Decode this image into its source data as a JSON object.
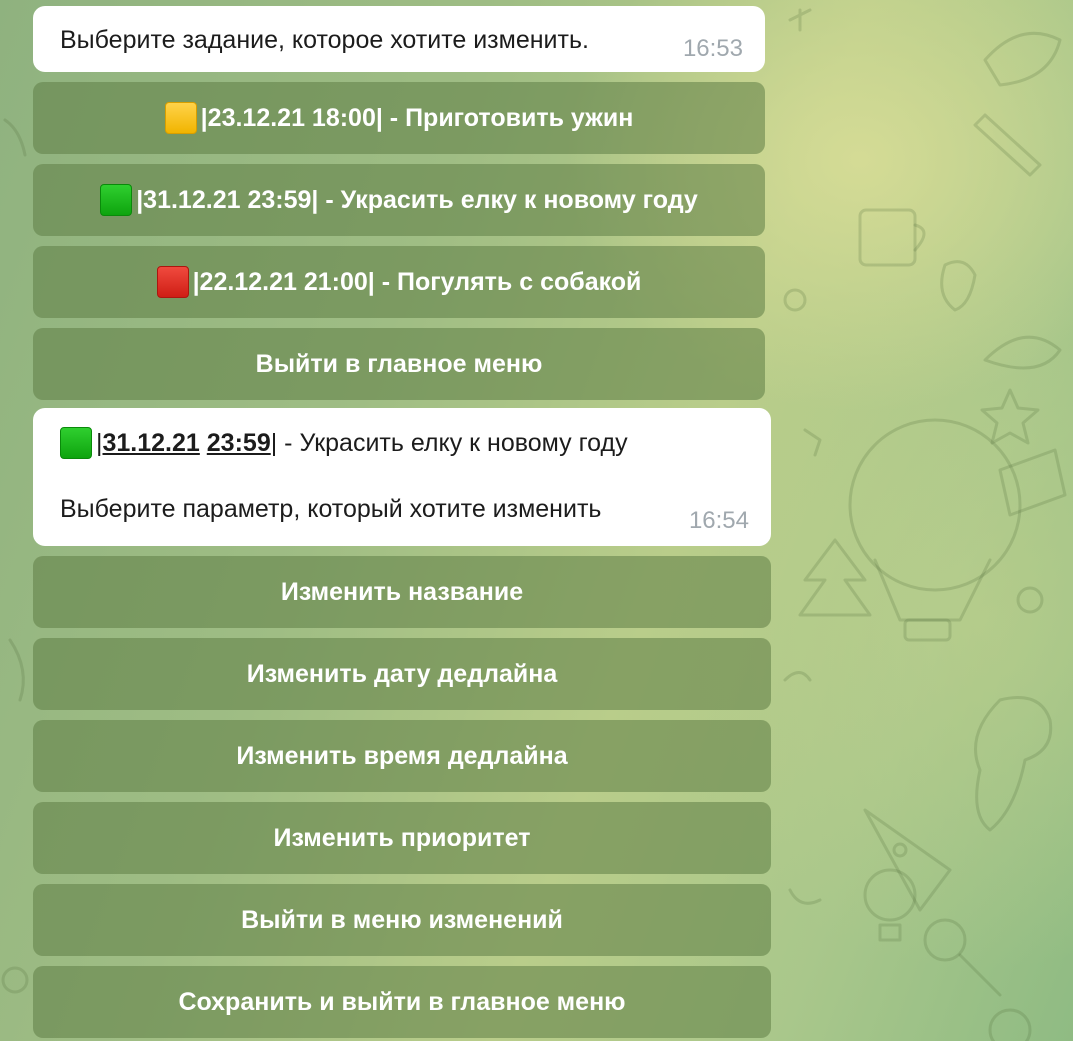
{
  "messages": [
    {
      "text": "Выберите задание, которое хотите изменить.",
      "time": "16:53"
    },
    {
      "task_color": "green",
      "task_prefix": "|",
      "task_date": "31.12.21",
      "task_time": "23:59",
      "task_suffix": "| - Украсить елку к новому году",
      "text": "Выберите параметр, который хотите изменить",
      "time": "16:54"
    }
  ],
  "keyboard1": [
    {
      "icon": "yellow-square-icon",
      "color": "yellow",
      "label": "|23.12.21 18:00| - Приготовить ужин"
    },
    {
      "icon": "green-square-icon",
      "color": "green",
      "label": "|31.12.21 23:59| - Украсить елку к новому году"
    },
    {
      "icon": "red-square-icon",
      "color": "red",
      "label": "|22.12.21 21:00| - Погулять с собакой"
    },
    {
      "icon": "",
      "color": "",
      "label": "Выйти в главное меню"
    }
  ],
  "keyboard2": [
    {
      "label": "Изменить название"
    },
    {
      "label": "Изменить дату дедлайна"
    },
    {
      "label": "Изменить время дедлайна"
    },
    {
      "label": "Изменить приоритет"
    },
    {
      "label": "Выйти в меню изменений"
    },
    {
      "label": "Сохранить и выйти в главное меню"
    }
  ],
  "colors": {
    "bubble": "#ffffff",
    "button_bg": "rgba(95,125,70,0.55)",
    "time": "#a0a8ae"
  }
}
